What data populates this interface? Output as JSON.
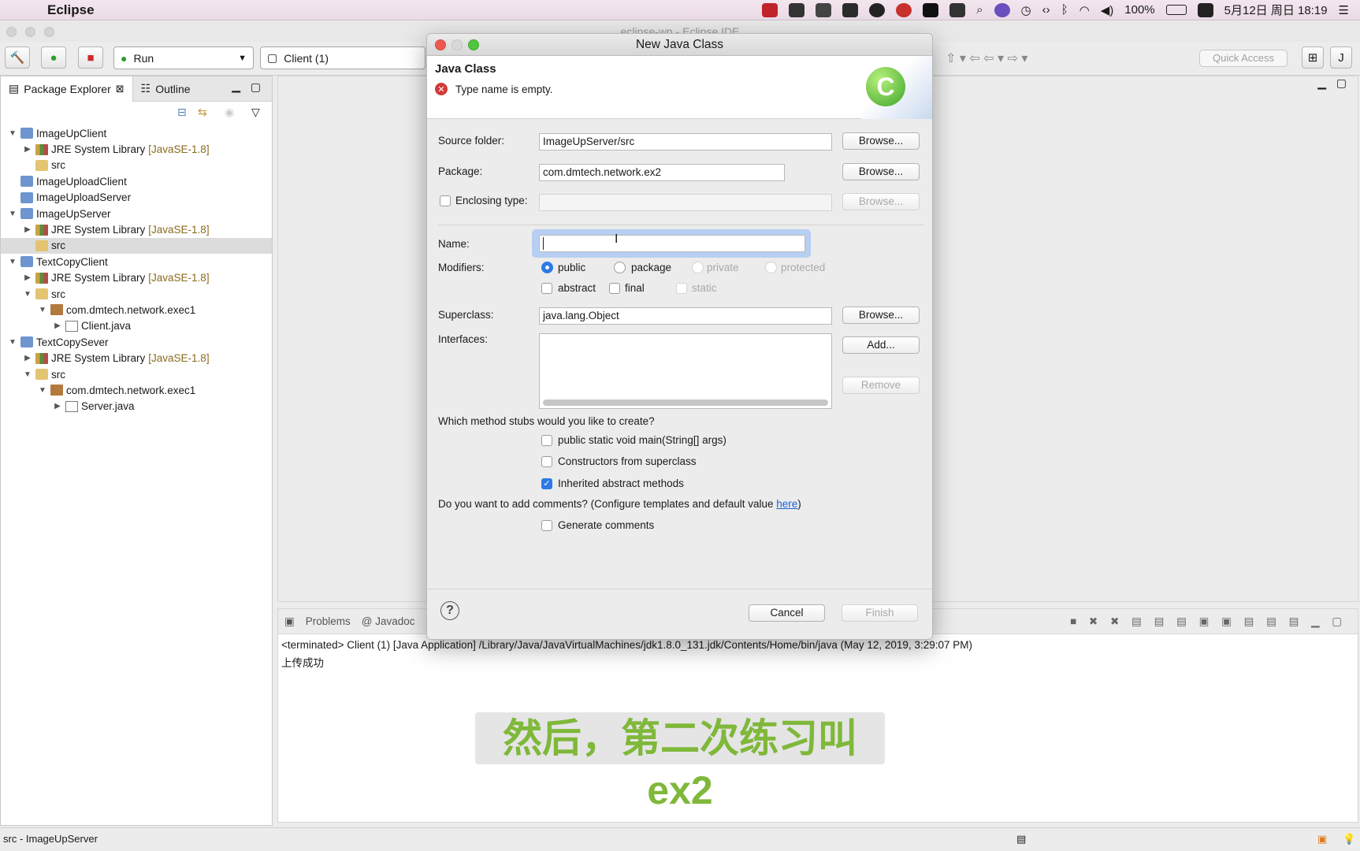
{
  "menubar": {
    "app_name": "Eclipse",
    "battery": "100%",
    "date_time": "5月12日 周日  18:19"
  },
  "window": {
    "title": "eclipse-wp - Eclipse IDE"
  },
  "toolbar": {
    "run_label": "Run",
    "client_label": "Client (1)",
    "quick_access": "Quick Access"
  },
  "package_explorer": {
    "tab_label": "Package Explorer",
    "outline_label": "Outline",
    "tree": [
      {
        "level": 0,
        "twisty": "▼",
        "icon": "proj",
        "label": "ImageUpClient",
        "tag": ""
      },
      {
        "level": 1,
        "twisty": "▶",
        "icon": "lib",
        "label": "JRE System Library",
        "tag": "[JavaSE-1.8]"
      },
      {
        "level": 1,
        "twisty": "",
        "icon": "folder",
        "label": "src",
        "tag": ""
      },
      {
        "level": 0,
        "twisty": "",
        "icon": "proj",
        "label": "ImageUploadClient",
        "tag": ""
      },
      {
        "level": 0,
        "twisty": "",
        "icon": "proj",
        "label": "ImageUploadServer",
        "tag": ""
      },
      {
        "level": 0,
        "twisty": "▼",
        "icon": "proj",
        "label": "ImageUpServer",
        "tag": ""
      },
      {
        "level": 1,
        "twisty": "▶",
        "icon": "lib",
        "label": "JRE System Library",
        "tag": "[JavaSE-1.8]"
      },
      {
        "level": 1,
        "twisty": "",
        "icon": "folder",
        "label": "src",
        "tag": "",
        "selected": true
      },
      {
        "level": 0,
        "twisty": "▼",
        "icon": "proj",
        "label": "TextCopyClient",
        "tag": ""
      },
      {
        "level": 1,
        "twisty": "▶",
        "icon": "lib",
        "label": "JRE System Library",
        "tag": "[JavaSE-1.8]"
      },
      {
        "level": 1,
        "twisty": "▼",
        "icon": "folder",
        "label": "src",
        "tag": ""
      },
      {
        "level": 2,
        "twisty": "▼",
        "icon": "pkg",
        "label": "com.dmtech.network.exec1",
        "tag": ""
      },
      {
        "level": 3,
        "twisty": "▶",
        "icon": "java",
        "label": "Client.java",
        "tag": ""
      },
      {
        "level": 0,
        "twisty": "▼",
        "icon": "proj",
        "label": "TextCopySever",
        "tag": ""
      },
      {
        "level": 1,
        "twisty": "▶",
        "icon": "lib",
        "label": "JRE System Library",
        "tag": "[JavaSE-1.8]"
      },
      {
        "level": 1,
        "twisty": "▼",
        "icon": "folder",
        "label": "src",
        "tag": ""
      },
      {
        "level": 2,
        "twisty": "▼",
        "icon": "pkg",
        "label": "com.dmtech.network.exec1",
        "tag": ""
      },
      {
        "level": 3,
        "twisty": "▶",
        "icon": "java",
        "label": "Server.java",
        "tag": ""
      }
    ]
  },
  "status_bar": {
    "text": "src - ImageUpServer"
  },
  "console": {
    "tabs": [
      "Problems",
      "@ Javadoc"
    ],
    "terminated": "<terminated> Client (1) [Java Application] /Library/Java/JavaVirtualMachines/jdk1.8.0_131.jdk/Contents/Home/bin/java (May 12, 2019, 3:29:07 PM)",
    "output": "上传成功"
  },
  "subtitle": "然后，第二次练习叫ex2",
  "dialog": {
    "title": "New Java Class",
    "header_title": "Java Class",
    "error_message": "Type name is empty.",
    "source_folder_label": "Source folder:",
    "source_folder_value": "ImageUpServer/src",
    "package_label": "Package:",
    "package_value": "com.dmtech.network.ex2",
    "enclosing_label": "Enclosing type:",
    "name_label": "Name:",
    "name_value": "",
    "modifiers_label": "Modifiers:",
    "modifiers": [
      "public",
      "package",
      "private",
      "protected"
    ],
    "mod_abstract": "abstract",
    "mod_final": "final",
    "mod_static": "static",
    "superclass_label": "Superclass:",
    "superclass_value": "java.lang.Object",
    "interfaces_label": "Interfaces:",
    "browse": "Browse...",
    "add": "Add...",
    "remove": "Remove",
    "stubs_question": "Which method stubs would you like to create?",
    "stub_main": "public static void main(String[] args)",
    "stub_constructors": "Constructors from superclass",
    "stub_inherited": "Inherited abstract methods",
    "comments_question": "Do you want to add comments? (Configure templates and default value ",
    "comments_link": "here",
    "comments_close": ")",
    "generate_comments": "Generate comments",
    "cancel": "Cancel",
    "finish": "Finish"
  }
}
